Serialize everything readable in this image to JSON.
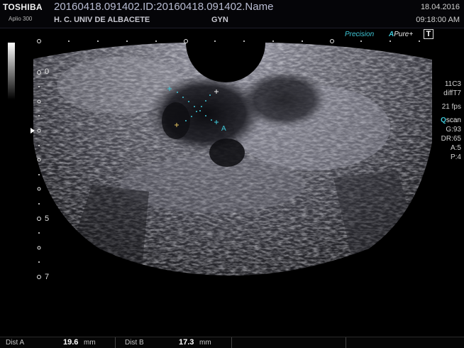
{
  "header": {
    "brand": "TOSHIBA",
    "model": "Aplio 300",
    "study_id": "20160418.091402.ID:20160418.091402.Name",
    "hospital": "H. C. UNIV DE ALBACETE",
    "department": "GYN",
    "date": "18.04.2016",
    "time": "09:18:00 AM"
  },
  "modes": {
    "precision": "Precision",
    "apure_a": "A",
    "apure_rest": "Pure+",
    "t_badge": "T"
  },
  "params": {
    "probe": "11C3",
    "preset": "diffT7",
    "frame_rate": "21 fps",
    "qscan_q": "Q",
    "qscan_rest": "scan",
    "gain": "G:93",
    "dynamic_range": "DR:65",
    "a_value": "A:5",
    "p_value": "P:4"
  },
  "depth_scale": {
    "label_0": "0",
    "label_5": "5",
    "label_7": "7"
  },
  "measurements": {
    "dist_a_label": "Dist A",
    "dist_a_value": "19.6",
    "dist_a_unit": "mm",
    "dist_b_label": "Dist B",
    "dist_b_value": "17.3",
    "dist_b_unit": "mm"
  },
  "caliper_markers": {
    "a_marker": "A"
  },
  "colors": {
    "accent_cyan": "#40c8d8",
    "caliper_yellow": "#e0c060"
  }
}
